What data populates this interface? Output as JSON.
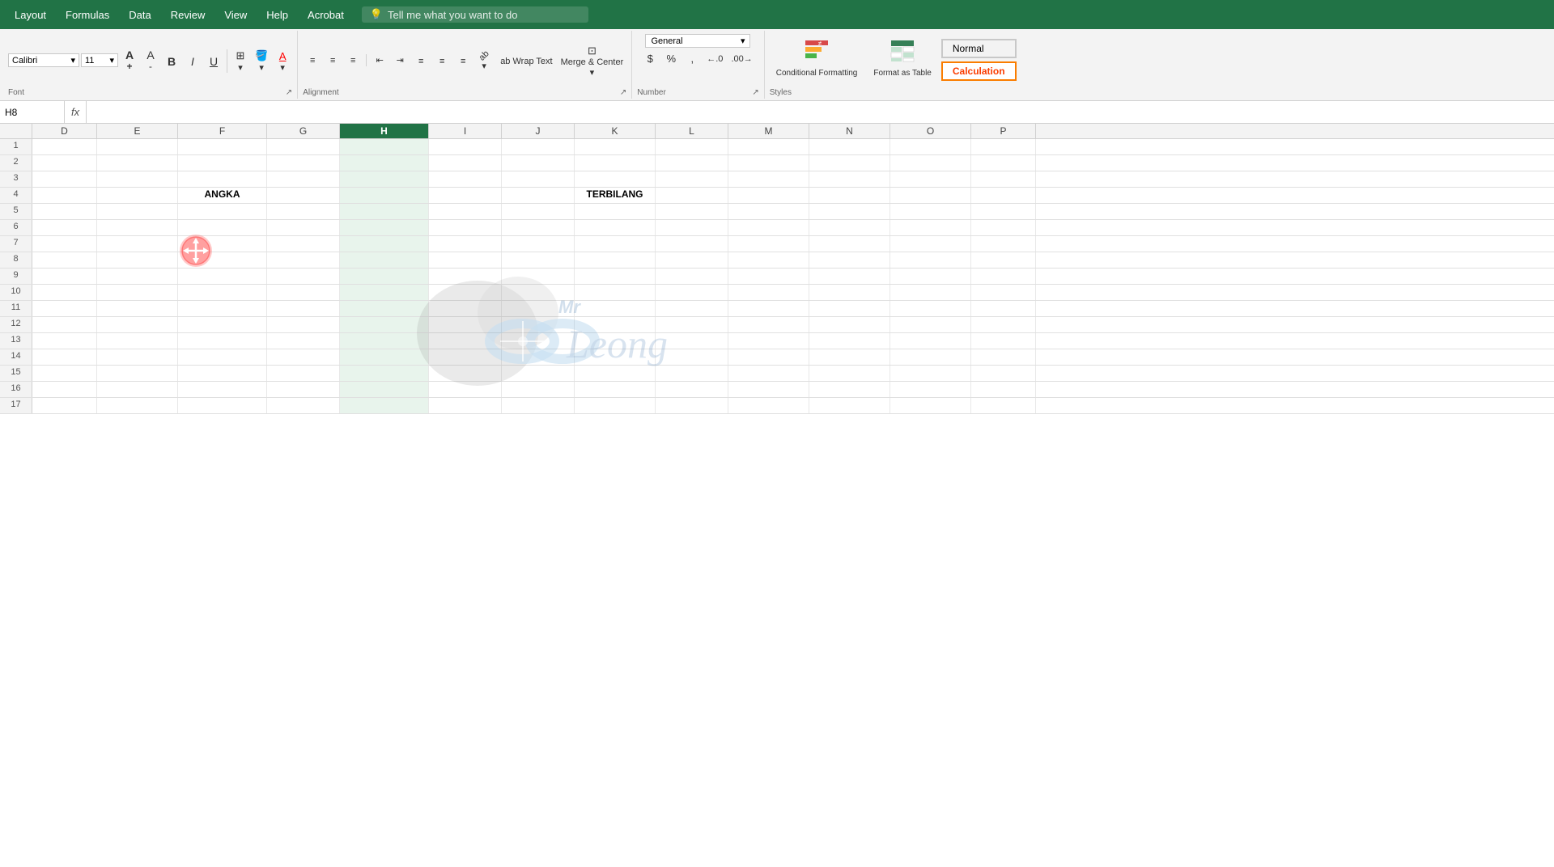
{
  "menubar": {
    "items": [
      "Layout",
      "Formulas",
      "Data",
      "Review",
      "View",
      "Help",
      "Acrobat"
    ],
    "search_placeholder": "Tell me what you want to do",
    "lightbulb_icon": "💡"
  },
  "ribbon": {
    "font_group": {
      "label": "Font",
      "font_name": "Calibri",
      "font_size": "11"
    },
    "alignment_group": {
      "label": "Alignment",
      "wrap_text": "ab Wrap Text",
      "merge_center": "Merge & Center"
    },
    "number_group": {
      "label": "Number",
      "format": "General"
    },
    "styles_group": {
      "label": "Styles",
      "conditional_formatting": "Conditional Formatting",
      "format_as_table": "Format as Table",
      "style_normal": "Normal",
      "style_calculation": "Calculation"
    }
  },
  "formula_bar": {
    "fx_label": "fx",
    "cell_ref": "H8",
    "formula_value": ""
  },
  "columns": [
    "D",
    "E",
    "F",
    "G",
    "H",
    "I",
    "J",
    "K",
    "L",
    "M",
    "N",
    "O",
    "P"
  ],
  "active_column": "H",
  "rows": [
    {
      "number": 1,
      "cells": {}
    },
    {
      "number": 2,
      "cells": {}
    },
    {
      "number": 3,
      "cells": {}
    },
    {
      "number": 4,
      "cells": {
        "F": "ANGKA",
        "K": "TERBILANG"
      }
    },
    {
      "number": 5,
      "cells": {}
    },
    {
      "number": 6,
      "cells": {}
    },
    {
      "number": 7,
      "cells": {}
    },
    {
      "number": 8,
      "cells": {
        "H": "",
        "selected": "H"
      }
    },
    {
      "number": 9,
      "cells": {}
    },
    {
      "number": 10,
      "cells": {}
    },
    {
      "number": 11,
      "cells": {}
    },
    {
      "number": 12,
      "cells": {}
    },
    {
      "number": 13,
      "cells": {}
    },
    {
      "number": 14,
      "cells": {}
    },
    {
      "number": 15,
      "cells": {}
    },
    {
      "number": 16,
      "cells": {}
    },
    {
      "number": 17,
      "cells": {}
    }
  ],
  "watermark": {
    "text": "Mr Leong"
  },
  "move_cursor_row": 7,
  "move_cursor_col": "F",
  "selected_cell": "H8"
}
